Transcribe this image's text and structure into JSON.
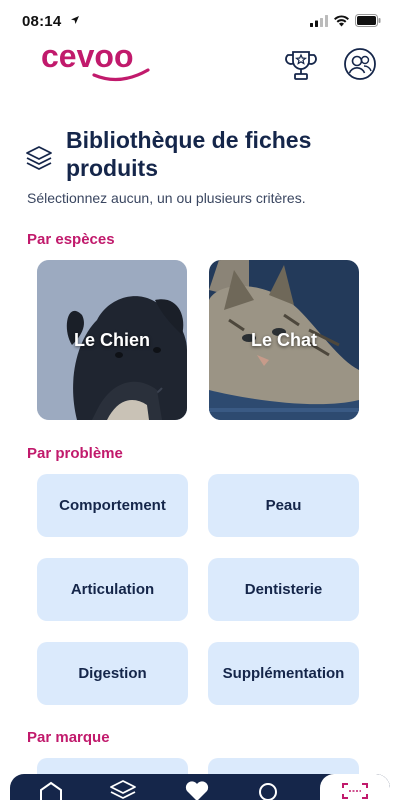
{
  "status_bar": {
    "time": "08:14"
  },
  "header": {
    "logo_text": "cevoo"
  },
  "page": {
    "title": "Bibliothèque de fiches produits",
    "subtitle": "Sélectionnez aucun, un ou plusieurs critères."
  },
  "sections": {
    "species": {
      "label": "Par espèces",
      "cards": [
        {
          "label": "Le Chien"
        },
        {
          "label": "Le Chat"
        }
      ]
    },
    "problems": {
      "label": "Par problème",
      "chips": [
        {
          "label": "Comportement"
        },
        {
          "label": "Peau"
        },
        {
          "label": "Articulation"
        },
        {
          "label": "Dentisterie"
        },
        {
          "label": "Digestion"
        },
        {
          "label": "Supplémentation"
        }
      ]
    },
    "brands": {
      "label": "Par marque"
    }
  },
  "tabbar": {
    "items": [
      {
        "icon": "home-icon"
      },
      {
        "icon": "layers-icon"
      },
      {
        "icon": "heart-icon"
      },
      {
        "icon": "search-icon"
      },
      {
        "icon": "scan-icon"
      }
    ]
  },
  "colors": {
    "brand_magenta": "#c11a6c",
    "navy": "#15264a",
    "chip_bg": "#dbeafc"
  }
}
